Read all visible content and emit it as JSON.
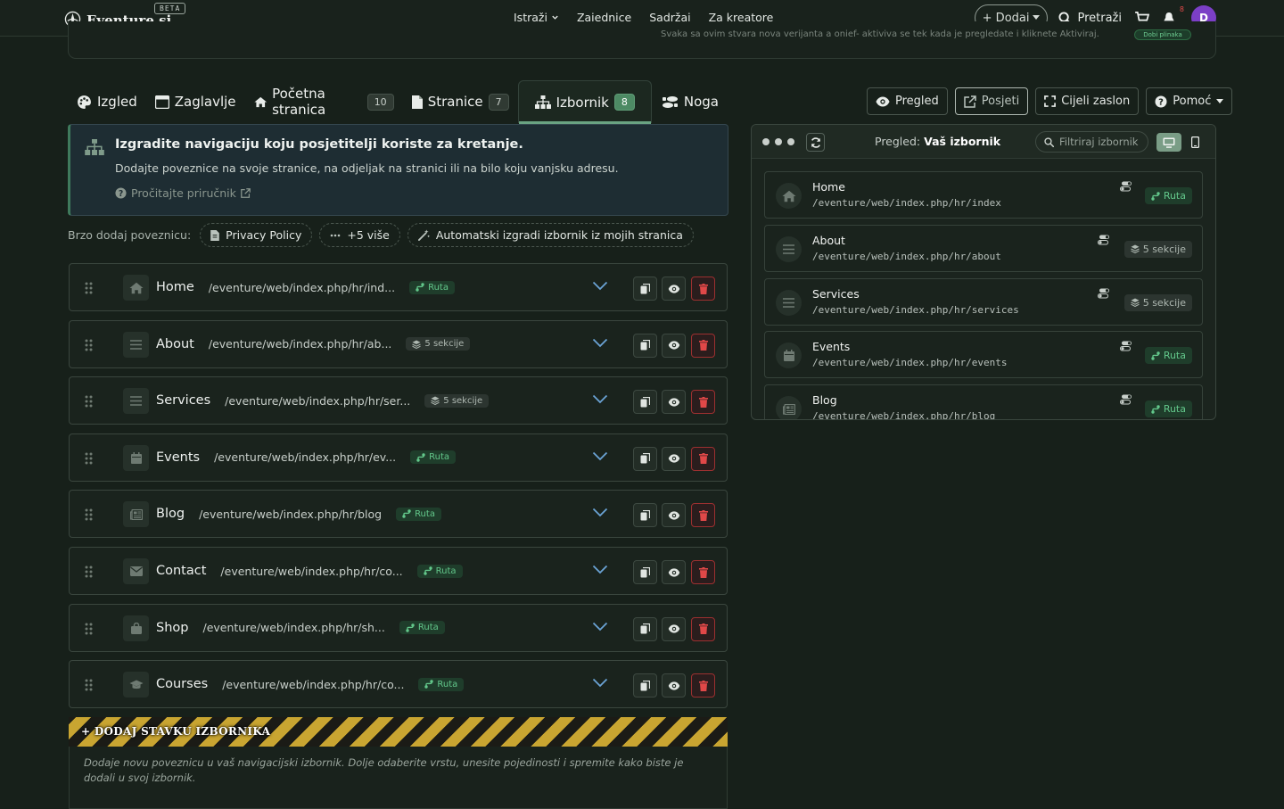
{
  "brand": {
    "name": "Eventure.si",
    "beta": "BETA"
  },
  "nav": {
    "links": [
      "Istraži",
      "Zajednice",
      "Sadržaj",
      "Za kreatore"
    ],
    "add": "+ Dodaj",
    "search": "Pretraži",
    "notifications": "8",
    "avatar": "D"
  },
  "topcard": {
    "text": "Svaka sa ovim stvara nova verijanta a onief- aktiviva se tek kada je pregledate i kliknete Aktiviraj.",
    "badge": "Dobi plinaka"
  },
  "tabs": [
    {
      "label": "Izgled",
      "icon": "palette-icon"
    },
    {
      "label": "Zaglavlje",
      "icon": "window-icon"
    },
    {
      "label": "Početna stranica",
      "count": "10",
      "icon": "home-icon"
    },
    {
      "label": "Stranice",
      "count": "7",
      "icon": "file-icon"
    },
    {
      "label": "Izbornik",
      "count": "8",
      "icon": "sitemap-icon",
      "active": true
    },
    {
      "label": "Noga",
      "icon": "shoe-prints-icon"
    }
  ],
  "actions": {
    "preview": "Pregled",
    "visit": "Posjeti",
    "fullscreen": "Cijeli zaslon",
    "help": "Pomoć"
  },
  "info": {
    "title": "Izgradite navigaciju koju posjetitelji koriste za kretanje.",
    "subtitle": "Dodajte poveznice na svoje stranice, na odjeljak na stranici ili na bilo koju vanjsku adresu.",
    "link": "Pročitajte priručnik"
  },
  "quick": {
    "label": "Brzo dodaj poveznicu:",
    "chips": [
      "Privacy Policy",
      "+5 više",
      "Automatski izgradi izbornik iz mojih stranica"
    ]
  },
  "menu_items": [
    {
      "title": "Home",
      "path": "/eventure/web/index.php/hr/ind...",
      "badge": "Ruta",
      "type": "ruta",
      "icon": "home-icon"
    },
    {
      "title": "About",
      "path": "/eventure/web/index.php/hr/ab...",
      "badge": "5 sekcije",
      "type": "sek",
      "icon": "bars-icon"
    },
    {
      "title": "Services",
      "path": "/eventure/web/index.php/hr/ser...",
      "badge": "5 sekcije",
      "type": "sek",
      "icon": "bars-icon"
    },
    {
      "title": "Events",
      "path": "/eventure/web/index.php/hr/ev...",
      "badge": "Ruta",
      "type": "ruta",
      "icon": "calendar-icon"
    },
    {
      "title": "Blog",
      "path": "/eventure/web/index.php/hr/blog",
      "badge": "Ruta",
      "type": "ruta",
      "icon": "newspaper-icon"
    },
    {
      "title": "Contact",
      "path": "/eventure/web/index.php/hr/co...",
      "badge": "Ruta",
      "type": "ruta",
      "icon": "envelope-icon"
    },
    {
      "title": "Shop",
      "path": "/eventure/web/index.php/hr/sh...",
      "badge": "Ruta",
      "type": "ruta",
      "icon": "shopping-bag-icon"
    },
    {
      "title": "Courses",
      "path": "/eventure/web/index.php/hr/co...",
      "badge": "Ruta",
      "type": "ruta",
      "icon": "graduation-cap-icon"
    }
  ],
  "add_item": {
    "label": "+ DODAJ STAVKU IZBORNIKA",
    "help": "Dodaje novu poveznicu u vaš navigacijski izbornik. Dolje odaberite vrstu, unesite pojedinosti i spremite kako biste je dodali u svoj izbornik."
  },
  "preview": {
    "title_prefix": "Pregled:",
    "title": "Vaš izbornik",
    "filter_placeholder": "Filtriraj izbornik",
    "items": [
      {
        "title": "Home",
        "path": "/eventure/web/index.php/hr/index",
        "badge": "Ruta",
        "type": "ruta",
        "icon": "home-icon"
      },
      {
        "title": "About",
        "path": "/eventure/web/index.php/hr/about",
        "badge": "5 sekcije",
        "type": "sek",
        "icon": "bars-icon"
      },
      {
        "title": "Services",
        "path": "/eventure/web/index.php/hr/services",
        "badge": "5 sekcije",
        "type": "sek",
        "icon": "bars-icon"
      },
      {
        "title": "Events",
        "path": "/eventure/web/index.php/hr/events",
        "badge": "Ruta",
        "type": "ruta",
        "icon": "calendar-icon"
      },
      {
        "title": "Blog",
        "path": "/eventure/web/index.php/hr/blog",
        "badge": "Ruta",
        "type": "ruta",
        "icon": "newspaper-icon"
      }
    ]
  }
}
